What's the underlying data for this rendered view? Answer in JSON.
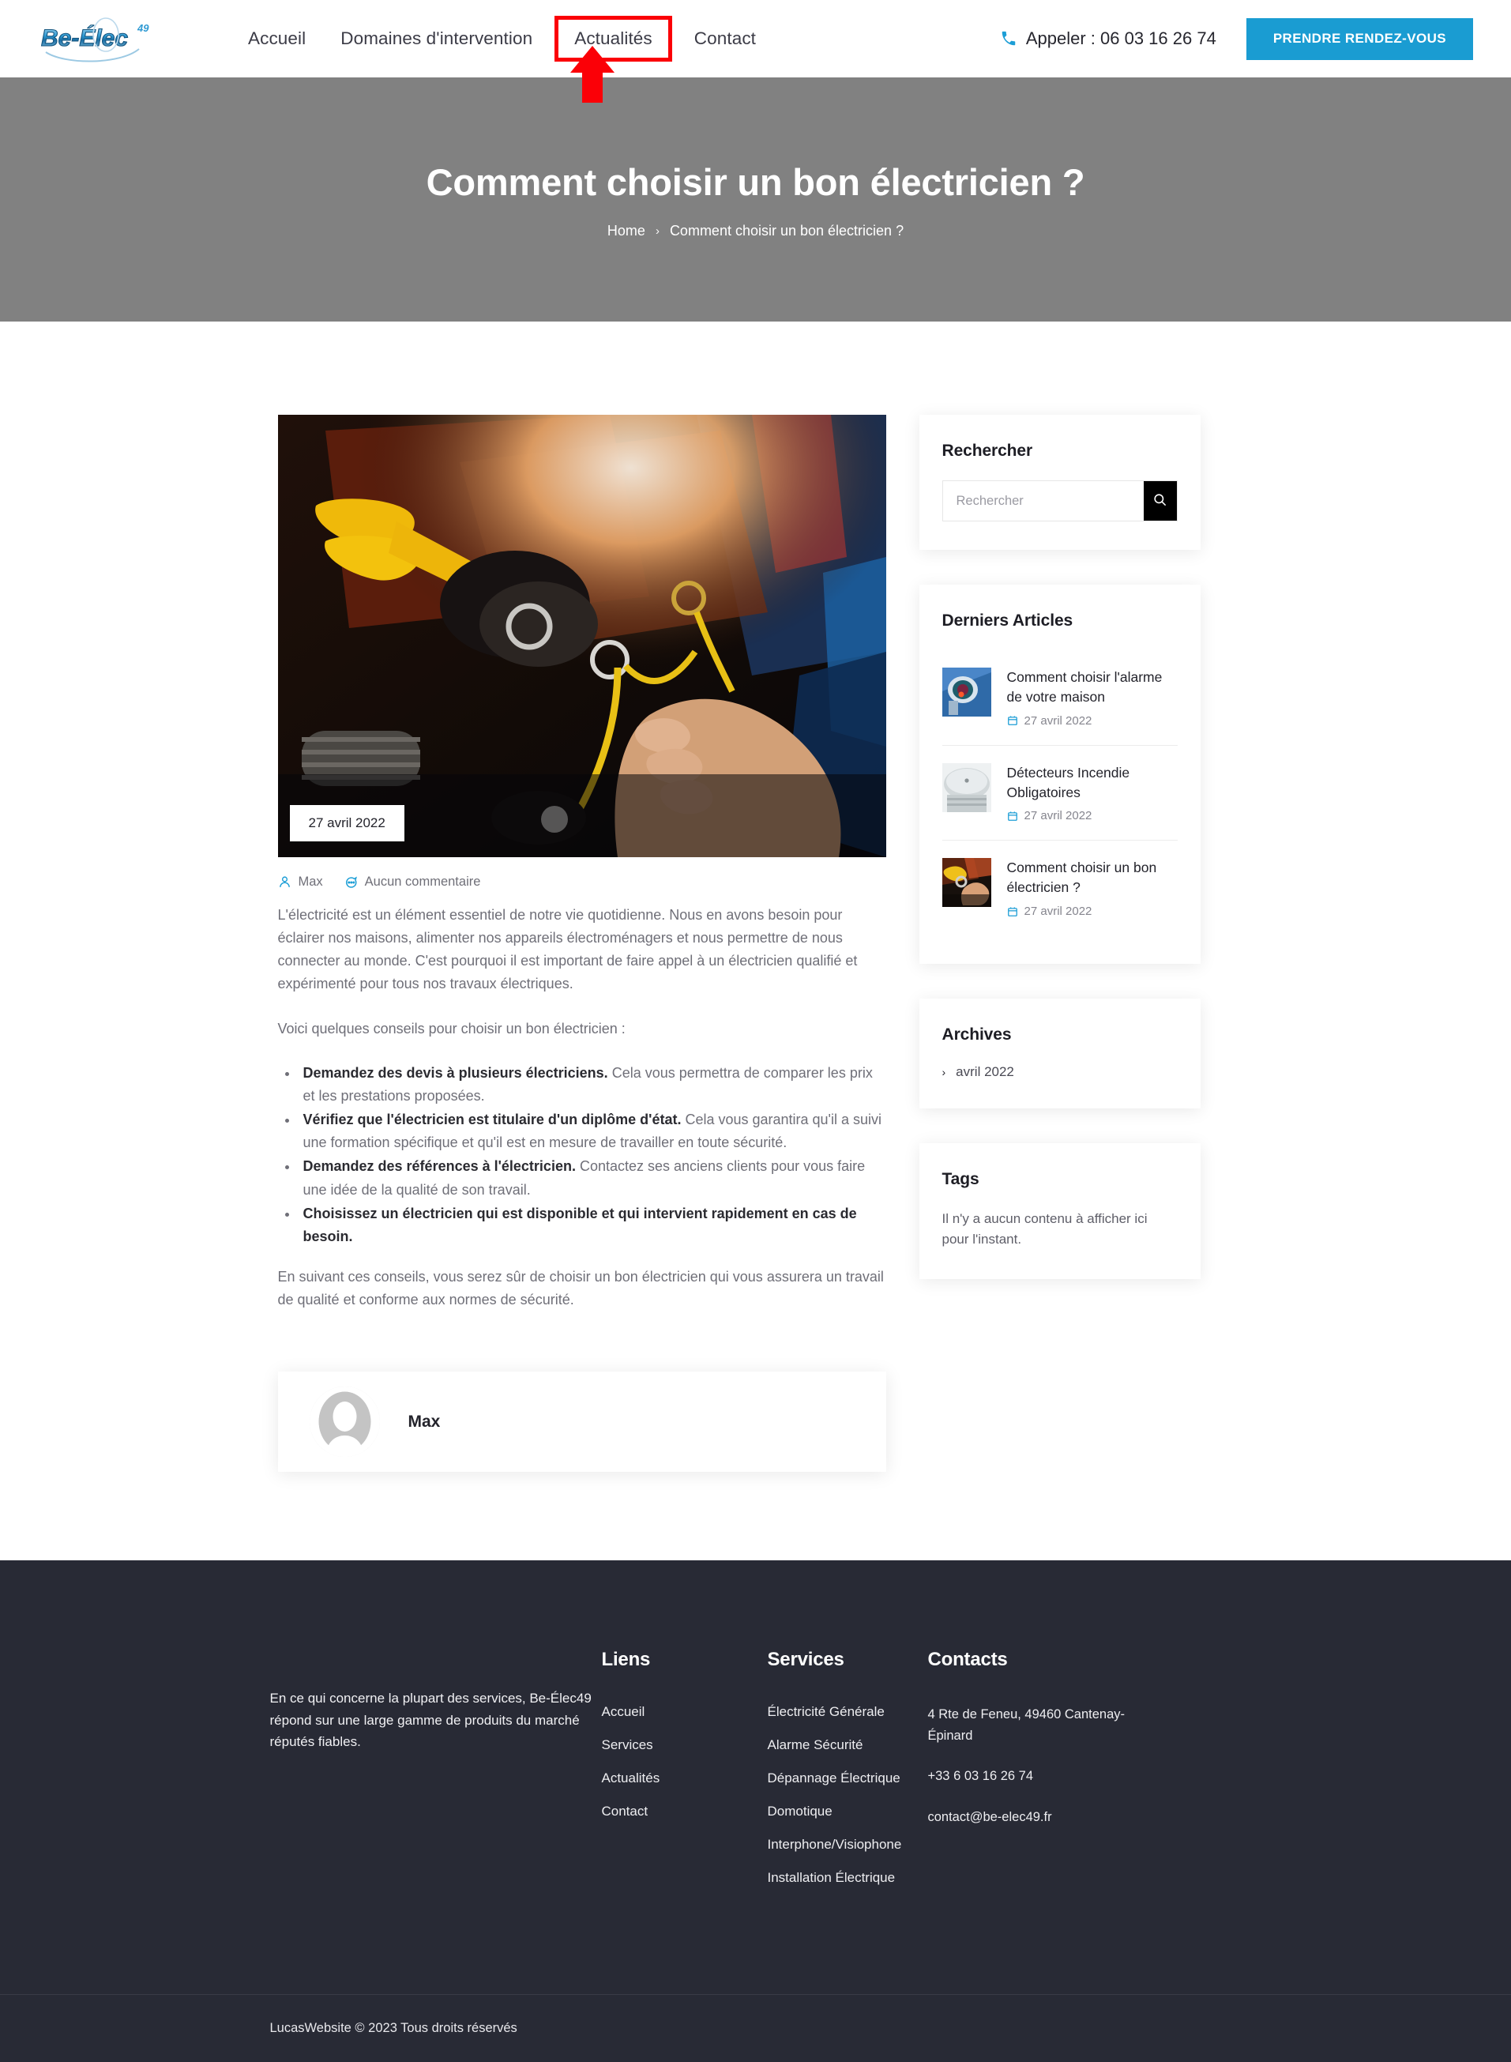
{
  "brand": {
    "logo_text": "Be-Élec",
    "logo_sup": "49"
  },
  "header": {
    "nav": [
      {
        "label": "Accueil",
        "highlighted": false
      },
      {
        "label": "Domaines d'intervention",
        "highlighted": false
      },
      {
        "label": "Actualités",
        "highlighted": true
      },
      {
        "label": "Contact",
        "highlighted": false
      }
    ],
    "phone_label": "Appeler : 06 03 16 26 74",
    "phone_icon": "phone-icon",
    "cta_label": "PRENDRE RENDEZ-VOUS",
    "cta_color": "#1a9cd2",
    "annotation_color": "#fb0007"
  },
  "hero": {
    "title": "Comment choisir un bon électricien ?",
    "background_color": "#818181",
    "breadcrumb": {
      "home": "Home",
      "separator": "›",
      "current": "Comment choisir un bon électricien ?"
    }
  },
  "post": {
    "date_badge": "27 avril 2022",
    "author": "Max",
    "comments": "Aucun commentaire",
    "paragraphs": [
      "L'électricité est un élément essentiel de notre vie quotidienne. Nous en avons besoin pour éclairer nos maisons, alimenter nos appareils électroménagers et nous permettre de nous connecter au monde. C'est pourquoi il est important de faire appel à un électricien qualifié et expérimenté pour tous nos travaux électriques.",
      "Voici quelques conseils pour choisir un bon électricien :"
    ],
    "tips": [
      {
        "bold": "Demandez des devis à plusieurs électriciens.",
        "rest": " Cela vous permettra de comparer les prix et les prestations proposées."
      },
      {
        "bold": "Vérifiez que l'électricien est titulaire d'un diplôme d'état.",
        "rest": " Cela vous garantira qu'il a suivi une formation spécifique et qu'il est en mesure de travailler en toute sécurité."
      },
      {
        "bold": "Demandez des références à l'électricien.",
        "rest": " Contactez ses anciens clients pour vous faire une idée de la qualité de son travail."
      },
      {
        "bold": "Choisissez un électricien qui est disponible et qui intervient rapidement en cas de besoin.",
        "rest": ""
      }
    ],
    "closing": "En suivant ces conseils, vous serez sûr de choisir un bon électricien qui vous assurera un travail de qualité et conforme aux normes de sécurité.",
    "author_box_name": "Max"
  },
  "sidebar": {
    "search": {
      "title": "Rechercher",
      "placeholder": "Rechercher",
      "value": "",
      "button_icon": "search-icon"
    },
    "recent": {
      "title": "Derniers Articles",
      "items": [
        {
          "title": "Comment choisir l'alarme de votre maison",
          "date": "27 avril 2022",
          "thumb": "security-camera"
        },
        {
          "title": "Détecteurs Incendie Obligatoires",
          "date": "27 avril 2022",
          "thumb": "smoke-detector"
        },
        {
          "title": "Comment choisir un bon électricien ?",
          "date": "27 avril 2022",
          "thumb": "electrician-hand"
        }
      ]
    },
    "archives": {
      "title": "Archives",
      "items": [
        {
          "label": "avril 2022"
        }
      ]
    },
    "tags": {
      "title": "Tags",
      "empty_text": "Il n'y a aucun contenu à afficher ici pour l'instant."
    }
  },
  "footer": {
    "about": "En ce qui concerne la plupart des services, Be-Élec49 répond sur une large gamme de produits du marché réputés fiables.",
    "links": {
      "title": "Liens",
      "items": [
        {
          "label": "Accueil"
        },
        {
          "label": "Services"
        },
        {
          "label": "Actualités"
        },
        {
          "label": "Contact"
        }
      ]
    },
    "services": {
      "title": "Services",
      "items": [
        {
          "label": "Électricité Générale"
        },
        {
          "label": "Alarme Sécurité"
        },
        {
          "label": "Dépannage Électrique"
        },
        {
          "label": "Domotique"
        },
        {
          "label": "Interphone/Visiophone"
        },
        {
          "label": "Installation Électrique"
        }
      ]
    },
    "contacts": {
      "title": "Contacts",
      "address": "4 Rte de Feneu, 49460 Cantenay-Épinard",
      "phone": "+33 6 03 16 26 74",
      "email": "contact@be-elec49.fr"
    },
    "copyright": "LucasWebsite © 2023 Tous droits réservés",
    "background_color": "#282a35"
  }
}
